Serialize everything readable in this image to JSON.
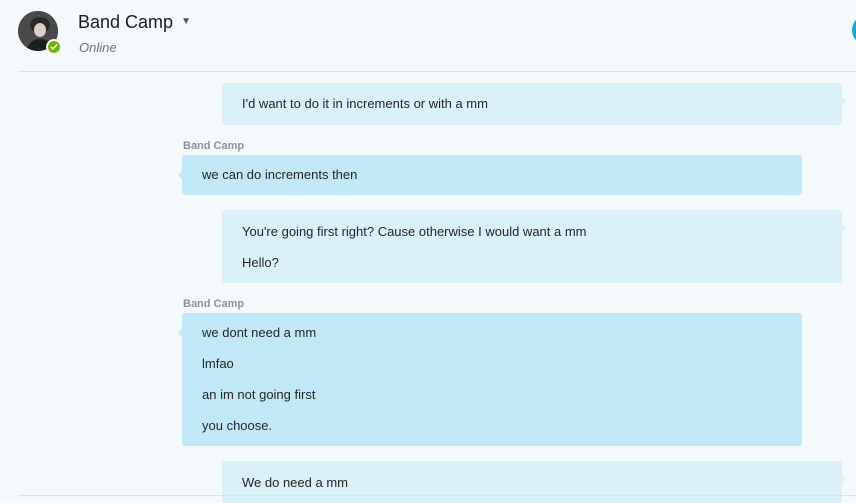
{
  "header": {
    "title": "Band Camp",
    "status": "Online",
    "colors": {
      "online": "#6bb700",
      "accent": "#00aff0"
    }
  },
  "messages": [
    {
      "direction": "out",
      "lines": [
        "I'd want to do it in increments or with a mm"
      ]
    },
    {
      "direction": "in",
      "sender": "Band Camp",
      "lines": [
        "we can do increments then"
      ]
    },
    {
      "direction": "out",
      "lines": [
        "You're going first right? Cause otherwise I would want a mm",
        "Hello?"
      ]
    },
    {
      "direction": "in",
      "sender": "Band Camp",
      "lines": [
        "we dont need a mm",
        "lmfao",
        "an im not going first",
        "you choose."
      ]
    },
    {
      "direction": "out",
      "lines": [
        "We do need a mm"
      ]
    }
  ]
}
